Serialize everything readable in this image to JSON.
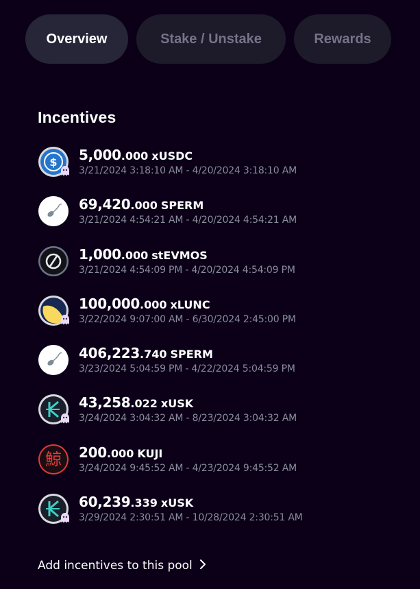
{
  "tabs": [
    {
      "label": "Overview",
      "active": true
    },
    {
      "label": "Stake / Unstake",
      "active": false
    },
    {
      "label": "Rewards",
      "active": false
    }
  ],
  "section_title": "Incentives",
  "incentives": [
    {
      "amount_int": "5,000",
      "amount_dec": ".000",
      "denom": "xUSDC",
      "range": "3/21/2024 3:18:10 AM - 4/20/2024 3:18:10 AM",
      "icon": "usdc-icon",
      "ghost_badge": true
    },
    {
      "amount_int": "69,420",
      "amount_dec": ".000",
      "denom": "SPERM",
      "range": "3/21/2024 4:54:21 AM - 4/20/2024 4:54:21 AM",
      "icon": "sperm-icon",
      "ghost_badge": false
    },
    {
      "amount_int": "1,000",
      "amount_dec": ".000",
      "denom": "stEVMOS",
      "range": "3/21/2024 4:54:09 PM - 4/20/2024 4:54:09 PM",
      "icon": "stevmos-icon",
      "ghost_badge": false
    },
    {
      "amount_int": "100,000",
      "amount_dec": ".000",
      "denom": "xLUNC",
      "range": "3/22/2024 9:07:00 AM - 6/30/2024 2:45:00 PM",
      "icon": "lunc-icon",
      "ghost_badge": true
    },
    {
      "amount_int": "406,223",
      "amount_dec": ".740",
      "denom": "SPERM",
      "range": "3/23/2024 5:04:59 PM - 4/22/2024 5:04:59 PM",
      "icon": "sperm-icon",
      "ghost_badge": false
    },
    {
      "amount_int": "43,258",
      "amount_dec": ".022",
      "denom": "xUSK",
      "range": "3/24/2024 3:04:32 AM - 8/23/2024 3:04:32 AM",
      "icon": "usk-icon",
      "ghost_badge": true
    },
    {
      "amount_int": "200",
      "amount_dec": ".000",
      "denom": "KUJI",
      "range": "3/24/2024 9:45:52 AM - 4/23/2024 9:45:52 AM",
      "icon": "kuji-icon",
      "ghost_badge": false
    },
    {
      "amount_int": "60,239",
      "amount_dec": ".339",
      "denom": "xUSK",
      "range": "3/29/2024 2:30:51 AM - 10/28/2024 2:30:51 AM",
      "icon": "usk-icon",
      "ghost_badge": true
    }
  ],
  "add_link": "Add incentives to this pool",
  "colors": {
    "background": "#0b0018",
    "tab_bg": "#1d1a2a",
    "tab_active_bg": "#262638",
    "muted_text": "#8a8d9b",
    "usdc_blue": "#2775ca",
    "kuji_red": "#e53935",
    "usk_teal": "#3ecfc4",
    "lunc_yellow": "#f9d85e"
  }
}
